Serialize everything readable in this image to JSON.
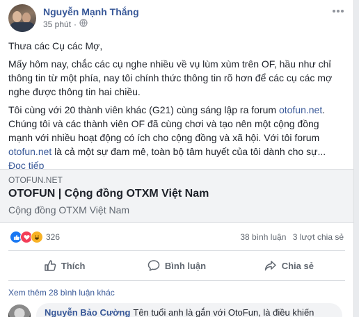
{
  "post": {
    "author": "Nguyễn Mạnh Thắng",
    "time": "35 phút",
    "privacy_icon": "globe-icon",
    "more_icon": "more-horizontal-icon",
    "paragraphs": {
      "p1": "Thưa các Cụ các Mợ,",
      "p2": "Mấy hôm nay, chắc các cụ nghe nhiều về vụ lùm xùm trên OF, hầu như chỉ thông tin từ một phía, nay tôi chính thức thông tin rõ hơn để các cụ các mợ nghe được thông tin hai chiều.",
      "p3_a": "Tôi cùng với 20 thành viên khác (G21) cùng sáng lập ra forum ",
      "p3_link1": "otofun.net",
      "p3_b": ". Chúng tôi và các thành viên OF đã cùng chơi và tạo nên một cộng đồng mạnh với nhiều hoạt động có ích cho cộng đồng và xã hội. Với tôi forum ",
      "p3_link2": "otofun.net",
      "p3_c": " là cả một sự đam mê, toàn bộ tâm huyết của tôi dành cho sự..."
    },
    "read_more": "Đọc tiếp"
  },
  "link_preview": {
    "domain": "OTOFUN.NET",
    "title": "OTOFUN | Cộng đồng OTXM Việt Nam",
    "description": "Cộng đồng OTXM Việt Nam"
  },
  "reactions": {
    "icons": [
      "like-icon",
      "love-icon",
      "haha-icon"
    ],
    "count": "326",
    "comments": "38 bình luận",
    "shares": "3 lượt chia sẻ"
  },
  "actions": {
    "like": "Thích",
    "comment": "Bình luận",
    "share": "Chia sẻ"
  },
  "comments": {
    "view_more": "Xem thêm 28 bình luận khác",
    "first": {
      "author": "Nguyễn Bảo Cường",
      "text": "Tên tuổi anh là gắn với OtoFun, là điều khiến"
    }
  },
  "colors": {
    "link": "#385898",
    "like": "#1877f2",
    "love": "#f33e58",
    "haha": "#f7b125"
  }
}
